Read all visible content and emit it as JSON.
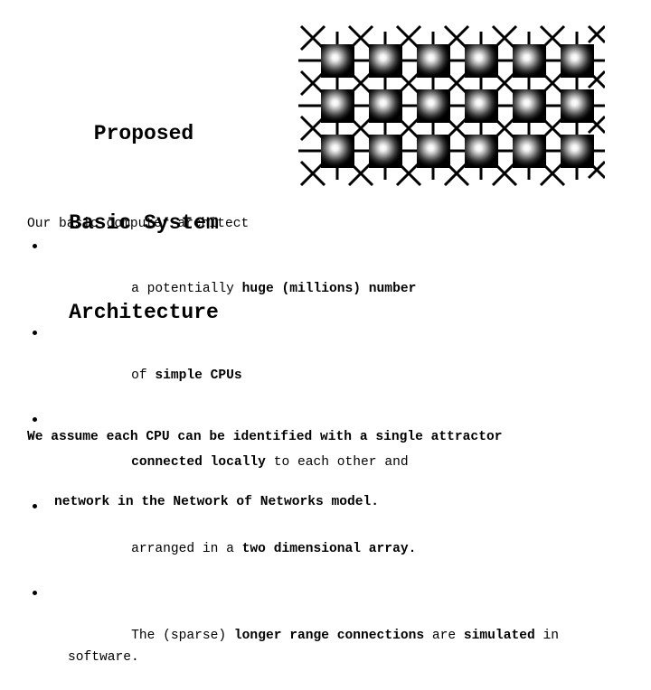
{
  "title": {
    "lines": [
      "Proposed",
      "Basic System",
      "Architecture"
    ]
  },
  "diagram": {
    "name": "processor-grid-diagram",
    "caption": "2D array of CPU nodes with local connections",
    "columns": 6,
    "rows": 3,
    "node_color": "#000000",
    "node_center_color": "#ffffff",
    "line_color": "#000000",
    "background": "#ffffff"
  },
  "body": {
    "lead": "Our basic computer architect",
    "bullets": [
      {
        "segments": [
          {
            "text": "a potentially ",
            "bold": false
          },
          {
            "text": "huge (millions) number",
            "bold": true
          }
        ]
      },
      {
        "segments": [
          {
            "text": "of ",
            "bold": false
          },
          {
            "text": "simple CPUs",
            "bold": true
          }
        ]
      },
      {
        "segments": [
          {
            "text": "connected locally",
            "bold": true
          },
          {
            "text": " to each other and",
            "bold": false
          }
        ]
      },
      {
        "segments": [
          {
            "text": "arranged in a ",
            "bold": false
          },
          {
            "text": "two dimensional array.",
            "bold": true
          }
        ]
      },
      {
        "segments": [
          {
            "text": "The (sparse) ",
            "bold": false
          },
          {
            "text": "longer range connections",
            "bold": true
          },
          {
            "text": " are ",
            "bold": false
          },
          {
            "text": "simulated",
            "bold": true
          },
          {
            "text": " in\nsoftware.",
            "bold": false
          }
        ]
      }
    ]
  },
  "closing": {
    "lines": [
      "We assume each CPU can be identified with a single attractor",
      "network in the Network of Networks model."
    ]
  }
}
